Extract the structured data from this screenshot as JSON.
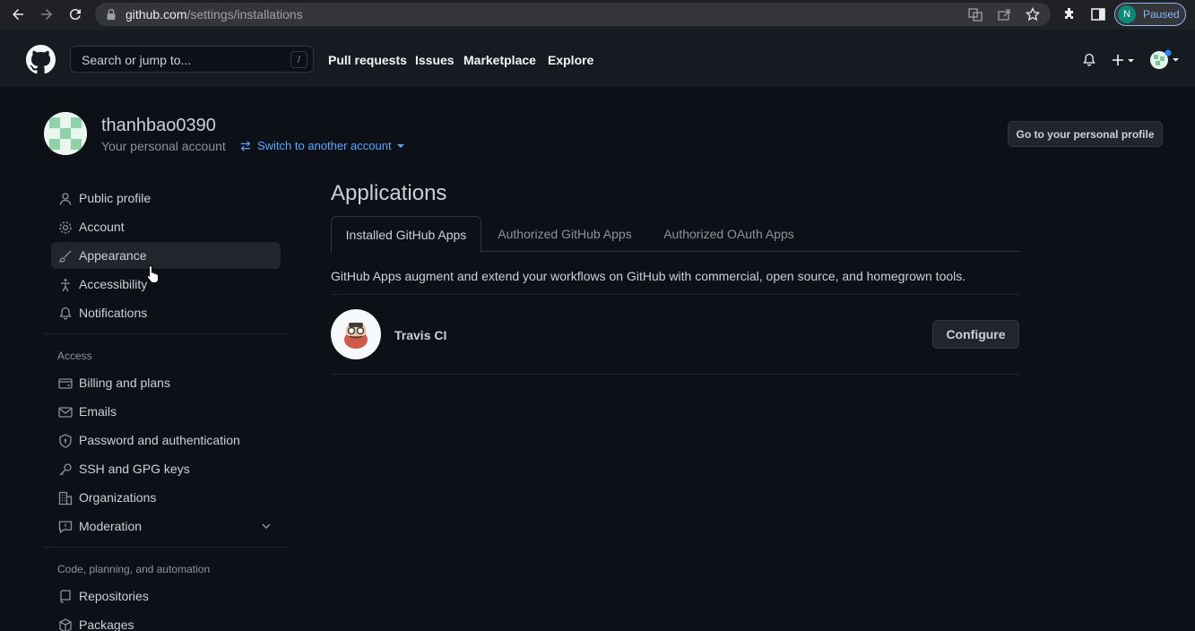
{
  "browser": {
    "url_host": "github.com",
    "url_path": "/settings/installations",
    "profile_initial": "N",
    "profile_status": "Paused"
  },
  "header": {
    "search_placeholder": "Search or jump to...",
    "search_shortcut": "/",
    "nav": [
      "Pull requests",
      "Issues",
      "Marketplace",
      "Explore"
    ]
  },
  "account": {
    "username": "thanhbao0390",
    "subtitle": "Your personal account",
    "switch_label": "Switch to another account",
    "profile_button": "Go to your personal profile"
  },
  "sidebar": {
    "group1": [
      {
        "label": "Public profile",
        "icon": "person-icon"
      },
      {
        "label": "Account",
        "icon": "gear-icon"
      },
      {
        "label": "Appearance",
        "icon": "paintbrush-icon",
        "active": true
      },
      {
        "label": "Accessibility",
        "icon": "accessibility-icon"
      },
      {
        "label": "Notifications",
        "icon": "bell-icon"
      }
    ],
    "access_heading": "Access",
    "group2": [
      {
        "label": "Billing and plans",
        "icon": "credit-card-icon"
      },
      {
        "label": "Emails",
        "icon": "mail-icon"
      },
      {
        "label": "Password and authentication",
        "icon": "shield-lock-icon"
      },
      {
        "label": "SSH and GPG keys",
        "icon": "key-icon"
      },
      {
        "label": "Organizations",
        "icon": "organization-icon"
      },
      {
        "label": "Moderation",
        "icon": "report-icon"
      }
    ],
    "code_heading": "Code, planning, and automation",
    "group3": [
      {
        "label": "Repositories",
        "icon": "repo-icon"
      },
      {
        "label": "Packages",
        "icon": "package-icon"
      }
    ]
  },
  "main": {
    "title": "Applications",
    "tabs": [
      "Installed GitHub Apps",
      "Authorized GitHub Apps",
      "Authorized OAuth Apps"
    ],
    "description": "GitHub Apps augment and extend your workflows on GitHub with commercial, open source, and homegrown tools.",
    "apps": [
      {
        "name": "Travis CI",
        "action": "Configure"
      }
    ]
  },
  "colors": {
    "background": "#0d1117",
    "header": "#161b22",
    "link": "#58a6ff",
    "border": "#30363d"
  }
}
